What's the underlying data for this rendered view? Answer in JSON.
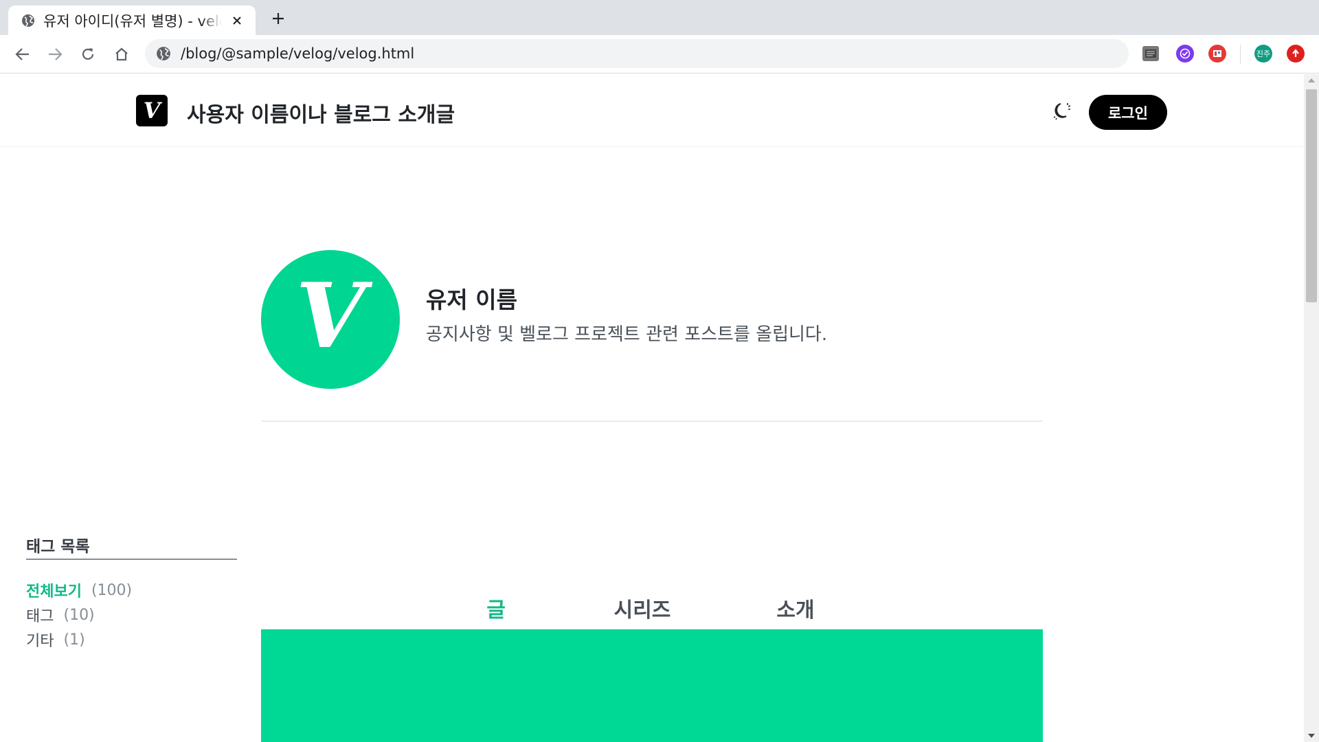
{
  "browser": {
    "tab_title": "유저 아이디(유저 별명) - velog",
    "url": "/blog/@sample/velog/velog.html",
    "extensions": [
      {
        "name": "notion-web-clipper-icon",
        "color": "#777777"
      },
      {
        "name": "check-circle-extension-icon",
        "color": "#7c3aed"
      },
      {
        "name": "rss-extension-icon",
        "color": "#e53935"
      },
      {
        "name": "profile-avatar",
        "label": "진주",
        "color": "#0f9d82"
      },
      {
        "name": "update-icon",
        "color": "#e02020"
      }
    ]
  },
  "header": {
    "logo": "V",
    "blog_title": "사용자 이름이나 블로그 소개글",
    "login_label": "로그인"
  },
  "profile": {
    "avatar_letter": "V",
    "name": "유저 이름",
    "description": "공지사항 및 벨로그 프로젝트 관련 포스트를 올립니다."
  },
  "tags": {
    "heading": "태그 목록",
    "items": [
      {
        "name": "전체보기",
        "count": "(100)",
        "active": true
      },
      {
        "name": "태그",
        "count": "(10)",
        "active": false
      },
      {
        "name": "기타",
        "count": "(1)",
        "active": false
      }
    ]
  },
  "tabs": [
    {
      "label": "글",
      "active": true
    },
    {
      "label": "시리즈",
      "active": false
    },
    {
      "label": "소개",
      "active": false
    }
  ],
  "colors": {
    "accent": "#12b886",
    "brand_green": "#00d592",
    "black": "#000000"
  }
}
